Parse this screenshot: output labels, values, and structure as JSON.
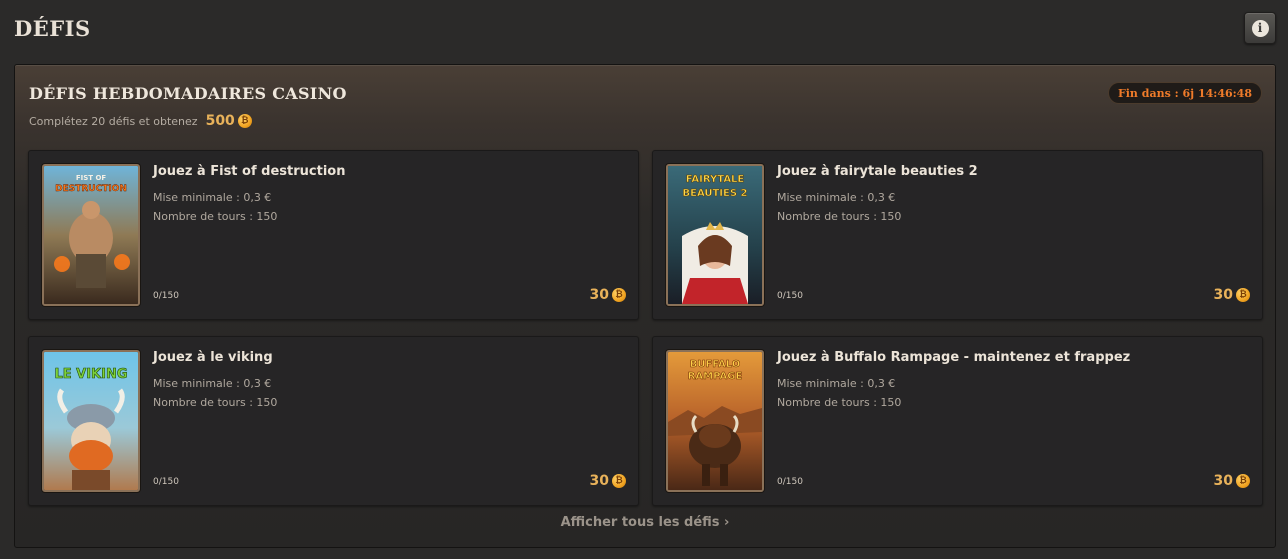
{
  "page": {
    "title": "DÉFIS",
    "info_icon": "info-icon"
  },
  "panel": {
    "title": "DÉFIS HEBDOMADAIRES CASINO",
    "timer": "Fin dans : 6j 14:46:48",
    "subtitle": "Complétez 20 défis et obtenez",
    "total_reward": "500",
    "show_all": "Afficher tous les défis ›"
  },
  "coin_glyph": "₿",
  "challenges": [
    {
      "title": "Jouez à Fist of destruction",
      "min_bet": "Mise minimale : 0,3 €",
      "rounds": "Nombre de tours : 150",
      "progress": "0/150",
      "reward": "30",
      "thumb_text": [
        "FIST OF",
        "DESTRUCTION"
      ]
    },
    {
      "title": "Jouez à fairytale beauties 2",
      "min_bet": "Mise minimale : 0,3 €",
      "rounds": "Nombre de tours : 150",
      "progress": "0/150",
      "reward": "30",
      "thumb_text": [
        "FAIRYTALE",
        "BEAUTIES 2"
      ]
    },
    {
      "title": "Jouez à le viking",
      "min_bet": "Mise minimale : 0,3 €",
      "rounds": "Nombre de tours : 150",
      "progress": "0/150",
      "reward": "30",
      "thumb_text": [
        "LE VIKING",
        ""
      ]
    },
    {
      "title": "Jouez à Buffalo Rampage - maintenez et frappez",
      "min_bet": "Mise minimale : 0,3 €",
      "rounds": "Nombre de tours : 150",
      "progress": "0/150",
      "reward": "30",
      "thumb_text": [
        "BUFFALO",
        "RAMPAGE"
      ]
    }
  ],
  "colors": {
    "accent_gold": "#e8b25a",
    "timer_orange": "#ef7b2a",
    "background": "#2b2a29"
  }
}
